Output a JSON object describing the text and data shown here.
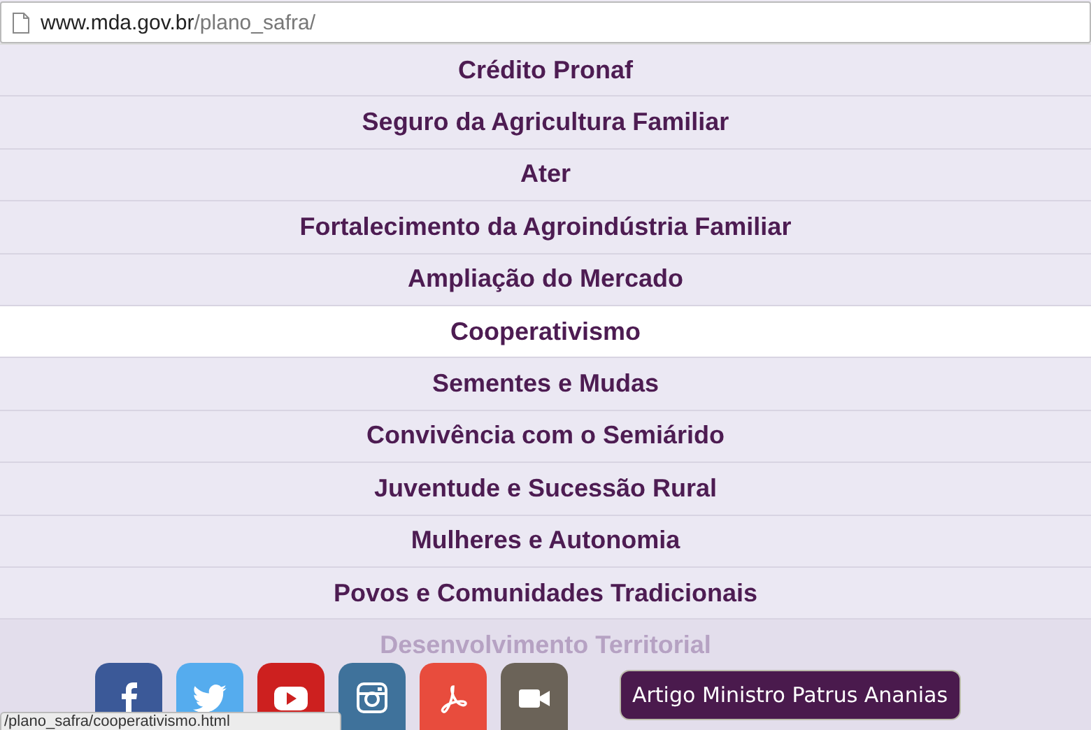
{
  "address_bar": {
    "host": "www.mda.gov.br",
    "path": "/plano_safra/"
  },
  "menu": [
    {
      "label": "Crédito Pronaf",
      "selected": false
    },
    {
      "label": "Seguro da Agricultura Familiar",
      "selected": false
    },
    {
      "label": "Ater",
      "selected": false
    },
    {
      "label": "Fortalecimento da Agroindústria Familiar",
      "selected": false
    },
    {
      "label": "Ampliação do Mercado",
      "selected": false
    },
    {
      "label": "Cooperativismo",
      "selected": true
    },
    {
      "label": "Sementes e Mudas",
      "selected": false
    },
    {
      "label": "Convivência com o Semiárido",
      "selected": false
    },
    {
      "label": "Juventude e Sucessão Rural",
      "selected": false
    },
    {
      "label": "Mulheres e Autonomia",
      "selected": false
    },
    {
      "label": "Povos e Comunidades Tradicionais",
      "selected": false
    },
    {
      "label": "Desenvolvimento Territorial",
      "selected": false
    }
  ],
  "footer": {
    "social_links": [
      {
        "kind": "f"
      },
      {
        "kind": "bird"
      },
      {
        "kind": "play"
      },
      {
        "kind": "camera"
      },
      {
        "kind": "pdf"
      },
      {
        "kind": "video"
      }
    ],
    "article_button": "Artigo Ministro Patrus Ananias"
  },
  "status_bar": "/plano_safra/cooperativismo.html"
}
